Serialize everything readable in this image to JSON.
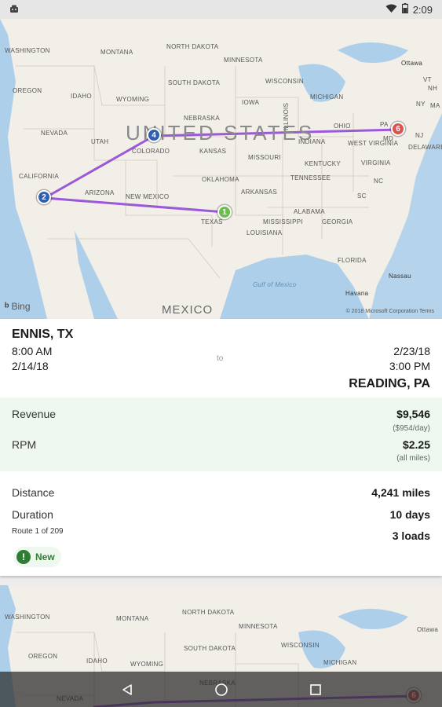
{
  "status_bar": {
    "time": "2:09"
  },
  "map": {
    "country_label": "UNITED STATES",
    "mexico_label": "MEXICO",
    "gulf_label": "Gulf of Mexico",
    "attribution": "Bing",
    "copyright": "© 2018 Microsoft Corporation  Terms",
    "states": [
      "WASHINGTON",
      "MONTANA",
      "NORTH DAKOTA",
      "MINNESOTA",
      "OREGON",
      "IDAHO",
      "WYOMING",
      "SOUTH DAKOTA",
      "WISCONSIN",
      "MICHIGAN",
      "IOWA",
      "NEBRASKA",
      "NEVADA",
      "UTAH",
      "COLORADO",
      "KANSAS",
      "MISSOURI",
      "ILLINOIS",
      "INDIANA",
      "OHIO",
      "WEST VIRGINIA",
      "VIRGINIA",
      "KENTUCKY",
      "CALIFORNIA",
      "ARIZONA",
      "NEW MEXICO",
      "OKLAHOMA",
      "ARKANSAS",
      "TENNESSEE",
      "NC",
      "SC",
      "ALABAMA",
      "GEORGIA",
      "MISSISSIPPI",
      "LOUISIANA",
      "TEXAS",
      "FLORIDA",
      "PA",
      "NY",
      "DELAWARE",
      "VT",
      "NH",
      "MA",
      "MD",
      "NJ"
    ],
    "cities": [
      "Ottawa",
      "Havana",
      "Nassau"
    ],
    "markers": [
      "1",
      "2",
      "4",
      "6"
    ]
  },
  "route": {
    "origin_city": "ENNIS, TX",
    "origin_time": "8:00 AM",
    "origin_date": "2/14/18",
    "to_label": "to",
    "dest_date": "2/23/18",
    "dest_time": "3:00 PM",
    "dest_city": "READING, PA"
  },
  "money": {
    "revenue_label": "Revenue",
    "revenue_value": "$9,546",
    "revenue_sub": "($954/day)",
    "rpm_label": "RPM",
    "rpm_value": "$2.25",
    "rpm_sub": "(all miles)"
  },
  "stats": {
    "distance_label": "Distance",
    "distance_value": "4,241 miles",
    "duration_label": "Duration",
    "duration_value": "10 days",
    "route_count": "Route 1 of 209",
    "loads_value": "3 loads",
    "badge_label": "New",
    "badge_icon": "!"
  },
  "colors": {
    "route_line": "#9b59d9",
    "marker_1": "#6abf4b",
    "marker_2": "#2f5fb0",
    "marker_4": "#2f5fb0",
    "marker_6": "#d9534f",
    "money_bg": "#eef8ef"
  }
}
